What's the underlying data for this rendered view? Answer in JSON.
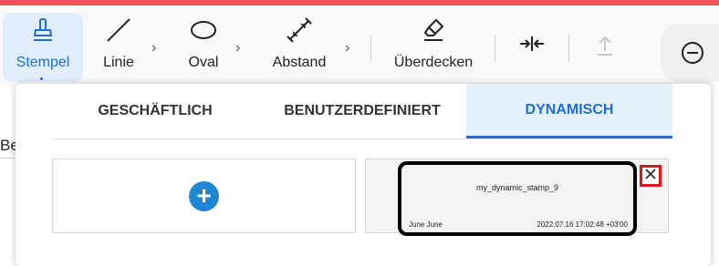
{
  "toolbar": {
    "tools": [
      {
        "label": "Stempel",
        "icon": "stamp-icon"
      },
      {
        "label": "Linie",
        "icon": "line-icon"
      },
      {
        "label": "Oval",
        "icon": "oval-icon"
      },
      {
        "label": "Abstand",
        "icon": "distance-icon"
      },
      {
        "label": "Überdecken",
        "icon": "eraser-icon"
      }
    ],
    "extra_icons": [
      "compare-arrows-icon",
      "upload-icon",
      "zoom-out-icon"
    ],
    "colors": {
      "accent": "#1f6fd1",
      "active_bg": "#e1eefb",
      "top_strip": "#e9575a"
    }
  },
  "background_text": "Be",
  "stamp_panel": {
    "tabs": [
      {
        "label": "GESCHÄFTLICH"
      },
      {
        "label": "BENUTZERDEFINIERT"
      },
      {
        "label": "DYNAMISCH"
      }
    ],
    "active_tab": "DYNAMISCH",
    "add_button_icon": "plus-icon",
    "stamps": [
      {
        "title": "my_dynamic_stamp_9",
        "left_text": "June June",
        "right_text": "2022.07.16 17:02:48 +03'00",
        "delete_icon": "close-icon"
      }
    ]
  }
}
